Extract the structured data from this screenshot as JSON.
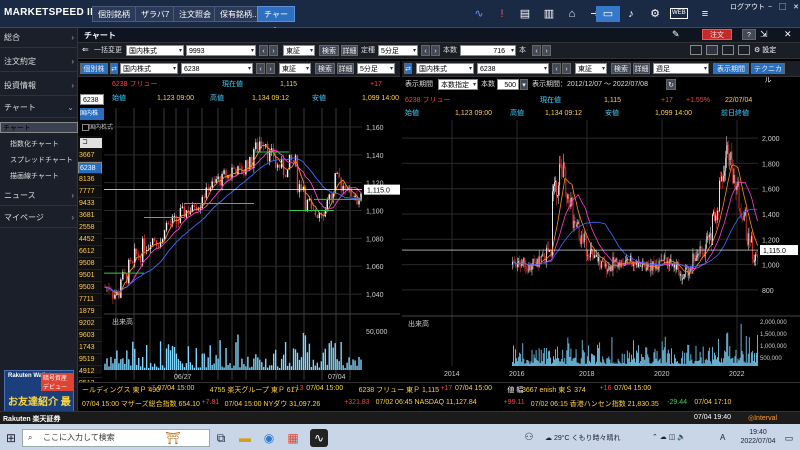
{
  "app": {
    "brand": "MARKETSPEED II",
    "logout": "ログアウト"
  },
  "top_tabs": [
    "個別銘柄",
    "ザラバ7",
    "注文照会",
    "保有銘柄...",
    "チャート"
  ],
  "top_icons": [
    "wave-icon",
    "alert-icon",
    "news-icon",
    "portfolio-icon",
    "home-icon",
    "login-icon",
    "window-icon",
    "bell-icon",
    "settings-icon",
    "web-icon",
    "menu-icon"
  ],
  "web_label": "WEB",
  "sidebar": {
    "items": [
      {
        "label": "総合",
        "chev": "›"
      },
      {
        "label": "注文約定",
        "chev": "›"
      },
      {
        "label": "投資情報",
        "chev": "›"
      },
      {
        "label": "チャート",
        "chev": "⌄"
      }
    ],
    "sub_items": [
      "チャート",
      "指数化チャート",
      "スプレッドチャート",
      "描画線チャート"
    ],
    "items2": [
      {
        "label": "ニュース",
        "chev": "›"
      },
      {
        "label": "マイページ",
        "chev": "›"
      }
    ]
  },
  "ad": {
    "logo": "Rakuten Wallet",
    "badge": "暗号資産デビュー",
    "text": "お友達紹介 最大3千円"
  },
  "panel": {
    "title": "チャート",
    "order_btn": "注文",
    "help": "?",
    "settings": "設定"
  },
  "toolbar1": {
    "bulk_label": "一括変更",
    "market": "国内株式",
    "code": "9993",
    "exchange": "東証",
    "search": "検索",
    "detail": "詳細",
    "fixed_label": "定種",
    "period": "5分足",
    "count_label": "本数",
    "count": "716",
    "count_unit": "本"
  },
  "left": {
    "tab": "個別株",
    "market": "国内株式",
    "code": "6238",
    "exchange": "東証",
    "search": "検索",
    "detail": "詳細",
    "period": "5分足",
    "code_input": "6238",
    "name": "6238 フリュー",
    "current_label": "現在値",
    "current": "1,115",
    "change": "+17",
    "open_label": "始値",
    "open": "1,123 09:00",
    "high_label": "高値",
    "high": "1,134 09:12",
    "low_label": "安値",
    "low": "1,099 14:00",
    "price_axis": [
      "1,160",
      "1,140",
      "1,120",
      "1,100",
      "1,080",
      "1,060",
      "1,040"
    ],
    "current_tag": "1,115.0",
    "volume_label": "出来高",
    "volume_axis": "50,000",
    "dates": [
      "06/27",
      "07/04"
    ],
    "watch_header": "国内株",
    "watch_title": "コ",
    "watch": [
      "3667",
      "6238",
      "8136",
      "7777",
      "9433",
      "3681",
      "2558",
      "4452",
      "6612",
      "9508",
      "9501",
      "9503",
      "7711",
      "1879",
      "9202",
      "9603",
      "1743",
      "9519",
      "4912",
      "9513"
    ]
  },
  "right": {
    "market": "国内株式",
    "code": "6238",
    "exchange": "東証",
    "search": "検索",
    "detail": "詳細",
    "period": "週足",
    "display_btn": "表示期間",
    "tech_btn": "テクニカル",
    "period_label": "表示期間",
    "period_sel": "本数指定",
    "count_label": "本数",
    "count": "500",
    "range": "表示期間：2012/12/07 〜 2022/07/08",
    "name": "6238 フリュー",
    "current_label": "現在値",
    "current": "1,115",
    "change": "+17",
    "change_pct": "+1.55%",
    "date": "22/07/04",
    "open_label": "始値",
    "open": "1,123 09:00",
    "high_label": "高値",
    "high": "1,134 09:12",
    "low_label": "安値",
    "low": "1,099 14:00",
    "prev_label": "前日終値",
    "price_axis": [
      "2,000",
      "1,800",
      "1,600",
      "1,400",
      "1,200",
      "1,000",
      "800"
    ],
    "current_tag": "1,115.0",
    "volume_label": "出来高",
    "volume_axis": [
      "2,000,000",
      "1,500,000",
      "1,000,000",
      "500,000"
    ],
    "years": [
      "2014",
      "2016",
      "2018",
      "2020",
      "2022"
    ]
  },
  "ticker1": [
    {
      "t": "ールディングス 東Ｐ 490 ",
      "c": "#ffd040"
    },
    {
      "t": "+7",
      "c": "#ff4040"
    },
    {
      "t": " 07/04 15:00",
      "c": "#ffd040"
    },
    {
      "t": "4755 楽天グループ 東Ｐ 617 ",
      "c": "#ffd040"
    },
    {
      "t": "+13",
      "c": "#ff4040"
    },
    {
      "t": " 07/04 15:00",
      "c": "#ffd040"
    },
    {
      "t": "6238 フリュー 東Ｐ 1,115 ",
      "c": "#ffd040"
    },
    {
      "t": "+17",
      "c": "#ff4040"
    },
    {
      "t": " 07/04 15:00",
      "c": "#ffd040"
    },
    {
      "t": "値 幅",
      "c": "#ffffff"
    },
    {
      "t": "3667 enish 東Ｓ 374 ",
      "c": "#ffd040"
    },
    {
      "t": "+16",
      "c": "#ff4040"
    },
    {
      "t": " 07/04 15:00",
      "c": "#ffd040"
    }
  ],
  "ticker2": [
    {
      "t": "07/04 15:00 マザーズ総合指数 654.10 ",
      "c": "#ffd040"
    },
    {
      "t": "+7.81",
      "c": "#ff4040"
    },
    {
      "t": " 07/04 15:00 NYダウ 31,097.26 ",
      "c": "#ffd040"
    },
    {
      "t": "+321.83",
      "c": "#ff4040"
    },
    {
      "t": " 07/02 06:45 NASDAQ 11,127.84 ",
      "c": "#ffd040"
    },
    {
      "t": "+99.11",
      "c": "#ff4040"
    },
    {
      "t": " 07/02 06:15 香港ハンセン指数 21,830.35 ",
      "c": "#ffd040"
    },
    {
      "t": "-29.44",
      "c": "#40d060"
    },
    {
      "t": " 07/04 17:10",
      "c": "#ffd040"
    }
  ],
  "status": {
    "brand": "Rakuten 楽天証券",
    "time": "07/04 19:40",
    "interval": "Interval"
  },
  "taskbar": {
    "search_placeholder": "ここに入力して検索",
    "weather": "29°C くもり時々晴れ",
    "clock_time": "19:40",
    "clock_date": "2022/07/04",
    "lang": "A"
  }
}
